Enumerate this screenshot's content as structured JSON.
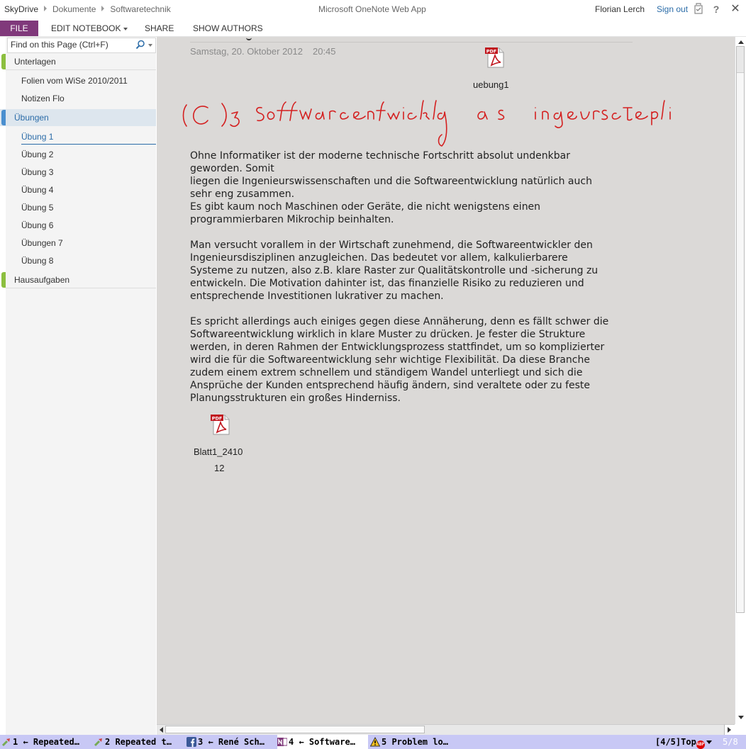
{
  "breadcrumb": [
    "SkyDrive",
    "Dokumente",
    "Softwaretechnik"
  ],
  "app_title": "Microsoft OneNote Web App",
  "user": {
    "name": "Florian Lerch",
    "sign_out": "Sign out"
  },
  "top_icons": [
    "checkin-icon",
    "help-icon",
    "close-icon"
  ],
  "ribbon": {
    "file": "FILE",
    "edit_notebook": "EDIT NOTEBOOK",
    "share": "SHARE",
    "show_authors": "SHOW AUTHORS"
  },
  "search": {
    "placeholder": "Find on this Page (Ctrl+F)"
  },
  "sidebar": {
    "sections": [
      {
        "label": "Unterlagen",
        "color": "#8cbf3f",
        "active": false,
        "pages": [
          "Folien vom WiSe 2010/2011",
          "Notizen Flo"
        ]
      },
      {
        "label": "Übungen",
        "color": "#4a8fcf",
        "active": true,
        "pages": [
          "Übung 1",
          "Übung 2",
          "Übung 3",
          "Übung 4",
          "Übung 5",
          "Übung 6",
          "Übungen 7",
          "Übung 8"
        ],
        "selected_page": "Übung 1"
      },
      {
        "label": "Hausaufgaben",
        "color": "#8cbf3f",
        "active": false,
        "pages": []
      }
    ]
  },
  "page": {
    "date": "Samstag, 20. Oktober 2012",
    "time": "20:45",
    "attachments": [
      {
        "badge": "PDF",
        "name": "uebung1"
      },
      {
        "badge": "PDF",
        "name_line1": "Blatt1_2410",
        "name_line2": "12"
      }
    ],
    "ink_color": "#d42020",
    "paragraphs": [
      [
        "Ohne Informatiker ist der moderne technische Fortschritt absolut undenkbar",
        "geworden. Somit",
        "liegen die Ingenieurswissenschaften und die Softwareentwicklung natürlich auch",
        "sehr eng zusammen.",
        "Es gibt kaum noch Maschinen oder Geräte, die nicht wenigstens einen",
        "programmierbaren Mikrochip beinhalten."
      ],
      [
        "Man versucht vorallem in der Wirtschaft zunehmend, die Softwareentwickler den",
        "Ingenieursdisziplinen anzugleichen. Das bedeutet vor allem, kalkulierbarere",
        "Systeme zu nutzen, also z.B. klare Raster zur Qualitätskontrolle und -sicherung zu",
        "entwickeln. Die Motivation dahinter ist, das finanzielle Risiko zu reduzieren und",
        "entsprechende Investitionen lukrativer zu machen."
      ],
      [
        "Es spricht allerdings auch einiges gegen diese Annäherung, denn es fällt schwer die",
        "Softwareentwicklung wirklich in klare Muster zu drücken. Je fester die Strukture",
        "werden, in deren Rahmen der Entwicklungsprozess stattfindet, um so komplizierter",
        "wird die für die Softwareentwicklung sehr wichtige Flexibilität. Da diese Branche",
        "zudem einem extrem schnellem und ständigem Wandel unterliegt und sich die",
        "Ansprüche der Kunden entsprechend häufig ändern, sind veraltete oder zu feste",
        "Planungsstrukturen ein großes Hinderniss."
      ]
    ]
  },
  "statusbar": {
    "tabs": [
      {
        "label": "1 ← Repeated…",
        "icon": "tools-icon"
      },
      {
        "label": "2 Repeated t…",
        "icon": "tools-icon"
      },
      {
        "label": "3 ← René Sch…",
        "icon": "facebook-icon"
      },
      {
        "label": "4 ← Software…",
        "icon": "onenote-icon"
      },
      {
        "label": "5 Problem lo…",
        "icon": "warning-icon"
      }
    ],
    "current_tab": 3,
    "position": "[4/5]Top",
    "tab_count": "5/8"
  }
}
